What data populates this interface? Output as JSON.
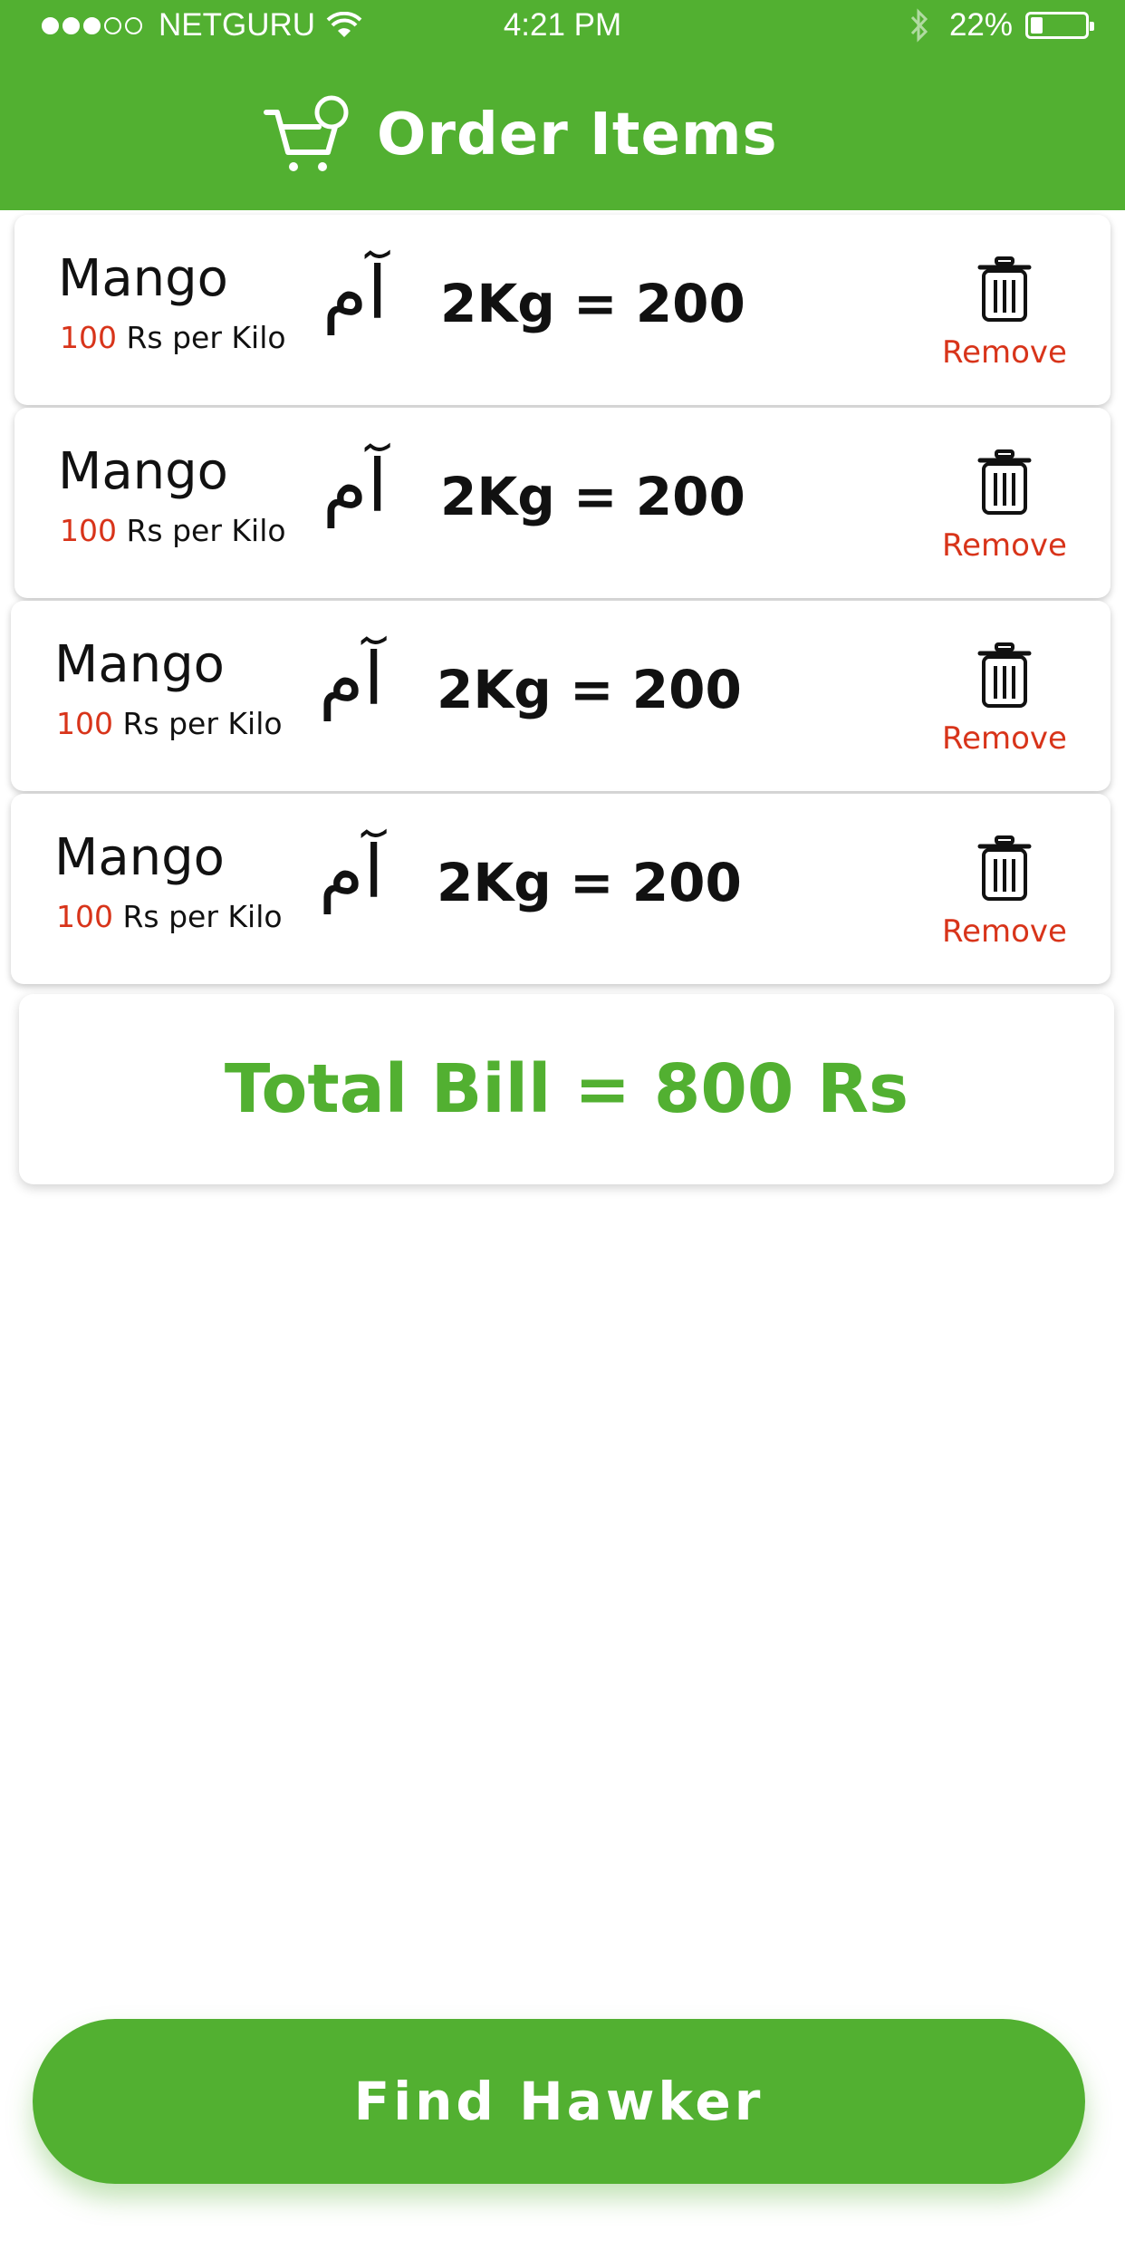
{
  "status_bar": {
    "signal_filled": 3,
    "signal_total": 5,
    "carrier": "NETGURU",
    "time": "4:21 PM",
    "battery_percent": "22%",
    "battery_level": 0.22
  },
  "header": {
    "title": "Order Items",
    "icon": "cart-icon",
    "background": "#52b031"
  },
  "items": [
    {
      "name": "Mango",
      "price": "100",
      "price_unit": "Rs per Kilo",
      "urdu_name": "آم",
      "quantity_text": "2Kg = 200",
      "remove_label": "Remove"
    },
    {
      "name": "Mango",
      "price": "100",
      "price_unit": "Rs per Kilo",
      "urdu_name": "آم",
      "quantity_text": "2Kg = 200",
      "remove_label": "Remove"
    },
    {
      "name": "Mango",
      "price": "100",
      "price_unit": "Rs per Kilo",
      "urdu_name": "آم",
      "quantity_text": "2Kg = 200",
      "remove_label": "Remove"
    },
    {
      "name": "Mango",
      "price": "100",
      "price_unit": "Rs per Kilo",
      "urdu_name": "آم",
      "quantity_text": "2Kg = 200",
      "remove_label": "Remove"
    }
  ],
  "total": {
    "text": "Total Bill = 800 Rs"
  },
  "footer": {
    "find_hawker_label": "Find Hawker"
  },
  "colors": {
    "brand_green": "#52b031",
    "remove_red": "#d8341a"
  }
}
